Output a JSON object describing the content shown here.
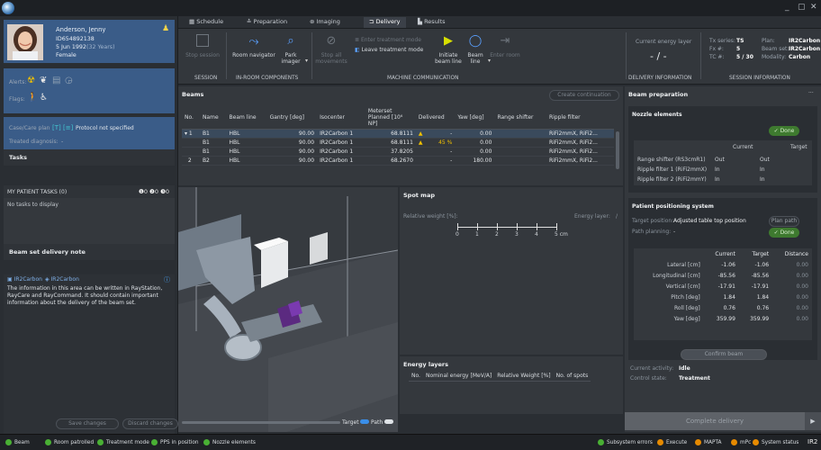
{
  "window": {
    "minimize": "_",
    "restore": "▢",
    "close": "✕"
  },
  "patient": {
    "name": "Anderson, Jenny",
    "id": "ID654892138",
    "dob": "5 Jun 1992",
    "age": "(32 Years)",
    "sex": "Female"
  },
  "alerts": {
    "alerts_label": "Alerts:",
    "flags_label": "Flags:"
  },
  "case": {
    "plan_label": "Case/Care plan",
    "protocol": "Protocol not specified",
    "diagnosis_label": "Treated diagnosis:",
    "diagnosis_value": "-"
  },
  "tasks": {
    "title": "Tasks",
    "header": "MY PATIENT TASKS (0)",
    "counts": [
      "0",
      "0",
      "0"
    ],
    "empty": "No tasks to display"
  },
  "note": {
    "title": "Beam set delivery note",
    "left_tag": "IR2Carbon",
    "right_tag": "IR2Carbon",
    "text": "The information in this area can be written in RayStation, RayCare and RayCommand. It should contain important information about the delivery of the beam set.",
    "save": "Save changes",
    "discard": "Discard changes"
  },
  "nav": {
    "tabs": [
      "Schedule",
      "Preparation",
      "Imaging",
      "Delivery",
      "Results"
    ]
  },
  "ribbon": {
    "stop_session": "Stop session",
    "room_navigator": "Room navigator",
    "park_imager": "Park imager",
    "stop_all": "Stop all movements",
    "enter_treatment": "Enter treatment mode",
    "leave_treatment": "Leave treatment mode",
    "initiate": "Initiate beam line",
    "beam_line": "Beam line",
    "enter_room": "Enter room",
    "cap_session": "SESSION",
    "cap_inroom": "IN-ROOM COMPONENTS",
    "cap_machine": "MACHINE COMMUNICATION",
    "energy_label": "Current energy layer",
    "energy_value": "- / -",
    "cap_delivery": "DELIVERY INFORMATION",
    "tx_series_l": "Tx series:",
    "tx_series_v": "TS",
    "fx_l": "Fx #:",
    "fx_v": "5",
    "tc_l": "TC #:",
    "tc_v": "5 / 30",
    "plan_l": "Plan:",
    "plan_v": "IR2Carbon",
    "beamset_l": "Beam set:",
    "beamset_v": "IR2Carbon",
    "modality_l": "Modality:",
    "modality_v": "Carbon",
    "cap_session_info": "SESSION INFORMATION"
  },
  "beams": {
    "title": "Beams",
    "continue": "Create continuation",
    "headers": [
      "No.",
      "Name",
      "Beam line",
      "Gantry [deg]",
      "Isocenter",
      "Meterset Planned [10⁶ NP]",
      "Delivered",
      "Yaw [deg]",
      "Range shifter",
      "Ripple filter"
    ],
    "rows": [
      {
        "no": "1",
        "name": "B1",
        "line": "HBL",
        "gantry": "90.00",
        "iso": "IR2Carbon 1",
        "meter": "68.8111",
        "delivered": "-",
        "yaw": "0.00",
        "rs": "",
        "rf": "RiFi2mmX, RiFi2..."
      },
      {
        "no": "",
        "name": "B1",
        "line": "HBL",
        "gantry": "90.00",
        "iso": "IR2Carbon 1",
        "meter": "68.8111",
        "delivered": "45 %",
        "yaw": "0.00",
        "rs": "",
        "rf": "RiFi2mmX, RiFi2..."
      },
      {
        "no": "",
        "name": "B1",
        "line": "HBL",
        "gantry": "90.00",
        "iso": "IR2Carbon 1",
        "meter": "37.8205",
        "delivered": "-",
        "yaw": "0.00",
        "rs": "",
        "rf": "RiFi2mmX, RiFi2..."
      },
      {
        "no": "2",
        "name": "B2",
        "line": "HBL",
        "gantry": "90.00",
        "iso": "IR2Carbon 1",
        "meter": "68.2670",
        "delivered": "-",
        "yaw": "180.00",
        "rs": "",
        "rf": "RiFi2mmX, RiFi2..."
      }
    ]
  },
  "view3d": {
    "target": "Target",
    "path": "Path"
  },
  "spotmap": {
    "title": "Spot map",
    "weight": "Relative weight [%]:",
    "energy": "Energy layer:",
    "energy_val": "/",
    "scale": [
      "0",
      "1",
      "2",
      "3",
      "4",
      "5 cm"
    ]
  },
  "energy": {
    "title": "Energy layers",
    "headers": [
      "No.",
      "Nominal energy [MeV/A]",
      "Relative Weight [%]",
      "No. of spots"
    ]
  },
  "prep": {
    "title": "Beam preparation",
    "more": "···",
    "nozzle_title": "Nozzle elements",
    "done": "Done",
    "current": "Current",
    "target": "Target",
    "nozzle_rows": [
      {
        "label": "Range shifter (RS3cmR1)",
        "current": "Out",
        "target": "Out"
      },
      {
        "label": "Ripple filter 1 (RiFi2mmX)",
        "current": "In",
        "target": "In"
      },
      {
        "label": "Ripple filter 2 (RiFi2mmY)",
        "current": "In",
        "target": "In"
      }
    ],
    "pps_title": "Patient positioning system",
    "target_pos_l": "Target position:",
    "target_pos_v": "Adjusted table top position",
    "plan_path": "Plan path",
    "path_planning_l": "Path planning:",
    "path_planning_v": "-",
    "pps_headers": [
      "Current",
      "Target",
      "Distance"
    ],
    "pps_rows": [
      {
        "label": "Lateral [cm]",
        "current": "-1.06",
        "target": "-1.06",
        "dist": "0.00"
      },
      {
        "label": "Longitudinal [cm]",
        "current": "-85.56",
        "target": "-85.56",
        "dist": "0.00"
      },
      {
        "label": "Vertical [cm]",
        "current": "-17.91",
        "target": "-17.91",
        "dist": "0.00"
      },
      {
        "label": "Pitch [deg]",
        "current": "1.84",
        "target": "1.84",
        "dist": "0.00"
      },
      {
        "label": "Roll [deg]",
        "current": "0.76",
        "target": "0.76",
        "dist": "0.00"
      },
      {
        "label": "Yaw [deg]",
        "current": "359.99",
        "target": "359.99",
        "dist": "0.00"
      }
    ],
    "confirm": "Confirm beam",
    "activity_l": "Current activity:",
    "activity_v": "Idle",
    "control_l": "Control state:",
    "control_v": "Treatment",
    "complete": "Complete delivery"
  },
  "status": {
    "left": [
      "Beam",
      "Room patrolled",
      "Treatment mode",
      "PPS in position",
      "Nozzle elements"
    ],
    "right": [
      "Subsystem errors",
      "Execute",
      "MAPTA",
      "mPc",
      "System status"
    ],
    "room": "IR2"
  }
}
